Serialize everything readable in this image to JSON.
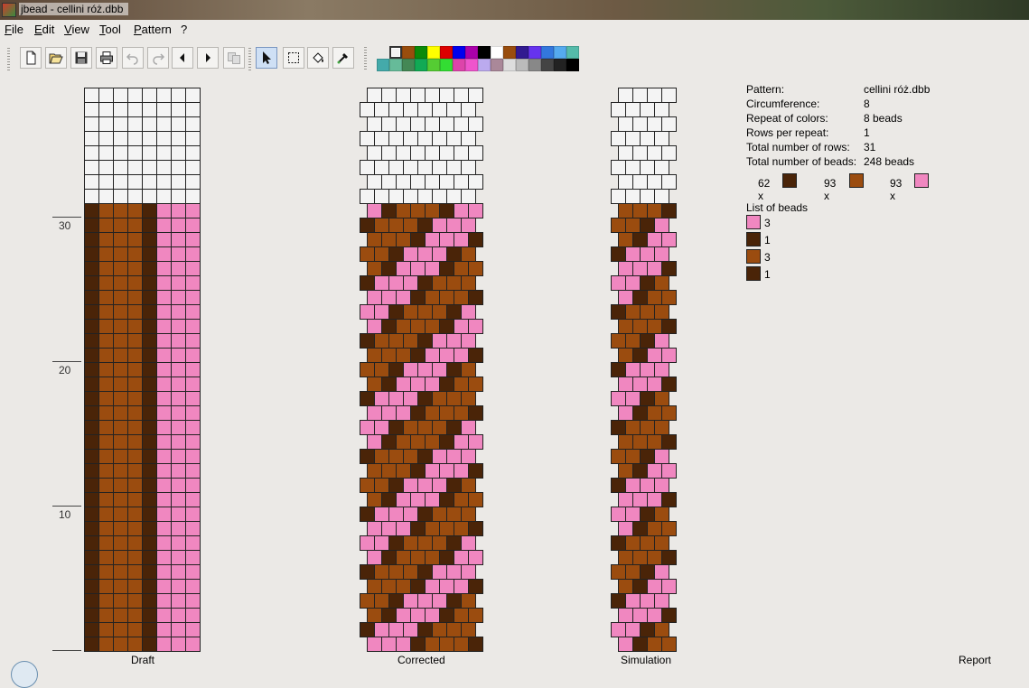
{
  "window": {
    "title": "jbead - cellini róż.dbb"
  },
  "menu": [
    "File",
    "Edit",
    "View",
    "Tool",
    "Pattern",
    "?"
  ],
  "toolbar": {
    "buttons": [
      {
        "name": "new-file-button",
        "icon": "new-file-icon",
        "enabled": true
      },
      {
        "name": "open-file-button",
        "icon": "open-folder-icon",
        "enabled": true
      },
      {
        "name": "save-button",
        "icon": "save-disk-icon",
        "enabled": true
      },
      {
        "name": "print-button",
        "icon": "printer-icon",
        "enabled": true
      },
      {
        "name": "undo-button",
        "icon": "undo-icon",
        "enabled": false
      },
      {
        "name": "redo-button",
        "icon": "redo-icon",
        "enabled": false
      },
      {
        "name": "scroll-left-button",
        "icon": "arrow-left-icon",
        "enabled": true
      },
      {
        "name": "scroll-right-button",
        "icon": "arrow-right-icon",
        "enabled": true
      },
      {
        "name": "copy-pattern-button",
        "icon": "copy-icon",
        "enabled": false
      },
      {
        "name": "pencil-tool-button",
        "icon": "pointer-icon",
        "enabled": true,
        "active": true
      },
      {
        "name": "select-tool-button",
        "icon": "selection-rect-icon",
        "enabled": true
      },
      {
        "name": "fill-tool-button",
        "icon": "paint-bucket-icon",
        "enabled": true
      },
      {
        "name": "pipette-tool-button",
        "icon": "pipette-icon",
        "enabled": true
      }
    ]
  },
  "colors": {
    "bead_dark": "#4a2408",
    "bead_brown": "#9b4c0f",
    "bead_pink": "#f087c0",
    "bead_empty": "#f4f4f4",
    "grid_line": "#222222"
  },
  "palette": {
    "selected_index": 0,
    "top_row": [
      "#f2f2f2",
      "#994d0d",
      "#0a8a0a",
      "#ffff00",
      "#dd0000",
      "#0000ee",
      "#aa00aa",
      "#000000",
      "#ffffff",
      "#994d0d",
      "#311a90",
      "#6633ee",
      "#3377dd",
      "#55aaee",
      "#55bbaa"
    ],
    "bottom_row": [
      "#44aaaa",
      "#66bb99",
      "#448855",
      "#11aa55",
      "#55cc33",
      "#33dd33",
      "#dd44aa",
      "#ee55cc",
      "#bbaaee",
      "#aa8899",
      "#dddddd",
      "#bbbbbb",
      "#888888",
      "#444444",
      "#222222",
      "#000000"
    ]
  },
  "pattern": {
    "width": 8,
    "filled_rows": 31,
    "visible_rows": 39,
    "draft_columns": [
      "dark",
      "brown",
      "brown",
      "brown",
      "dark",
      "pink",
      "pink",
      "pink"
    ],
    "repeat_sequence": [
      "pink",
      "pink",
      "pink",
      "dark",
      "brown",
      "brown",
      "brown",
      "dark"
    ]
  },
  "ruler": {
    "labels": [
      "30",
      "20",
      "10"
    ],
    "label_rows": [
      30,
      20,
      10
    ]
  },
  "panels": {
    "draft": "Draft",
    "corrected": "Corrected",
    "simulation": "Simulation",
    "report": "Report"
  },
  "report": {
    "fields": [
      {
        "label": "Pattern:",
        "value": "cellini róż.dbb"
      },
      {
        "label": "Circumference:",
        "value": "8"
      },
      {
        "label": "Repeat of colors:",
        "value": "8 beads"
      },
      {
        "label": "Rows per repeat:",
        "value": "1"
      },
      {
        "label": "Total number of rows:",
        "value": "31"
      },
      {
        "label": "Total number of beads:",
        "value": "248 beads"
      }
    ],
    "color_counts": [
      {
        "text": "62 x",
        "color": "dark"
      },
      {
        "text": "93 x",
        "color": "brown"
      },
      {
        "text": "93 x",
        "color": "pink"
      }
    ],
    "list_title": "List of beads",
    "bead_list": [
      {
        "count": "3",
        "color": "pink"
      },
      {
        "count": "1",
        "color": "dark"
      },
      {
        "count": "3",
        "color": "brown"
      },
      {
        "count": "1",
        "color": "dark"
      }
    ]
  }
}
